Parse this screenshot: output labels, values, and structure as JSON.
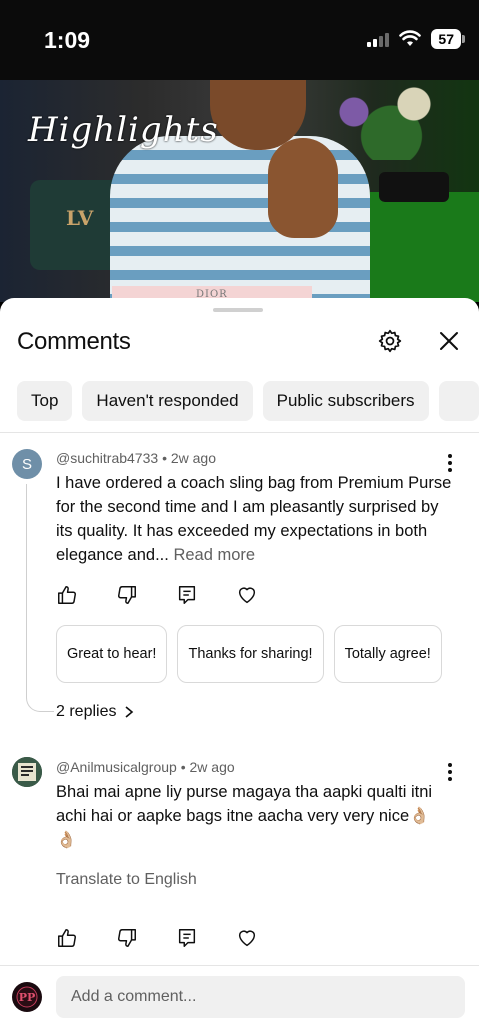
{
  "status_bar": {
    "time": "1:09",
    "battery": "57"
  },
  "video": {
    "overlay_text": "Highlights",
    "bag_logo": "LV",
    "paper_text": "DIOR"
  },
  "comments_panel": {
    "title": "Comments",
    "icons": {
      "settings": "gear-icon",
      "close": "close-icon"
    },
    "filters": [
      "Top",
      "Haven't responded",
      "Public subscribers"
    ],
    "comments": [
      {
        "avatar_letter": "S",
        "avatar_color": "#6f8fa8",
        "author": "@suchitrab4733",
        "age": "2w ago",
        "text": "I have ordered a coach sling bag from Premium Purse for the second time and I am pleasantly surprised by its quality. It has exceeded my expectations in both elegance and...",
        "read_more": "Read more",
        "suggested_replies": [
          "Great to hear!",
          "Thanks for sharing!",
          "Totally agree!"
        ],
        "replies": "2 replies"
      },
      {
        "author": "@Anilmusicalgroup",
        "age": "2w ago",
        "text": "Bhai mai apne liy purse magaya tha aapki qualti itni achi hai or aapke bags itne aacha very very nice",
        "emojis": "👌🏼👌🏼",
        "translate": "Translate to English"
      }
    ],
    "actions": [
      "like-icon",
      "dislike-icon",
      "reply-icon",
      "heart-icon"
    ]
  },
  "composer": {
    "placeholder": "Add a comment..."
  }
}
